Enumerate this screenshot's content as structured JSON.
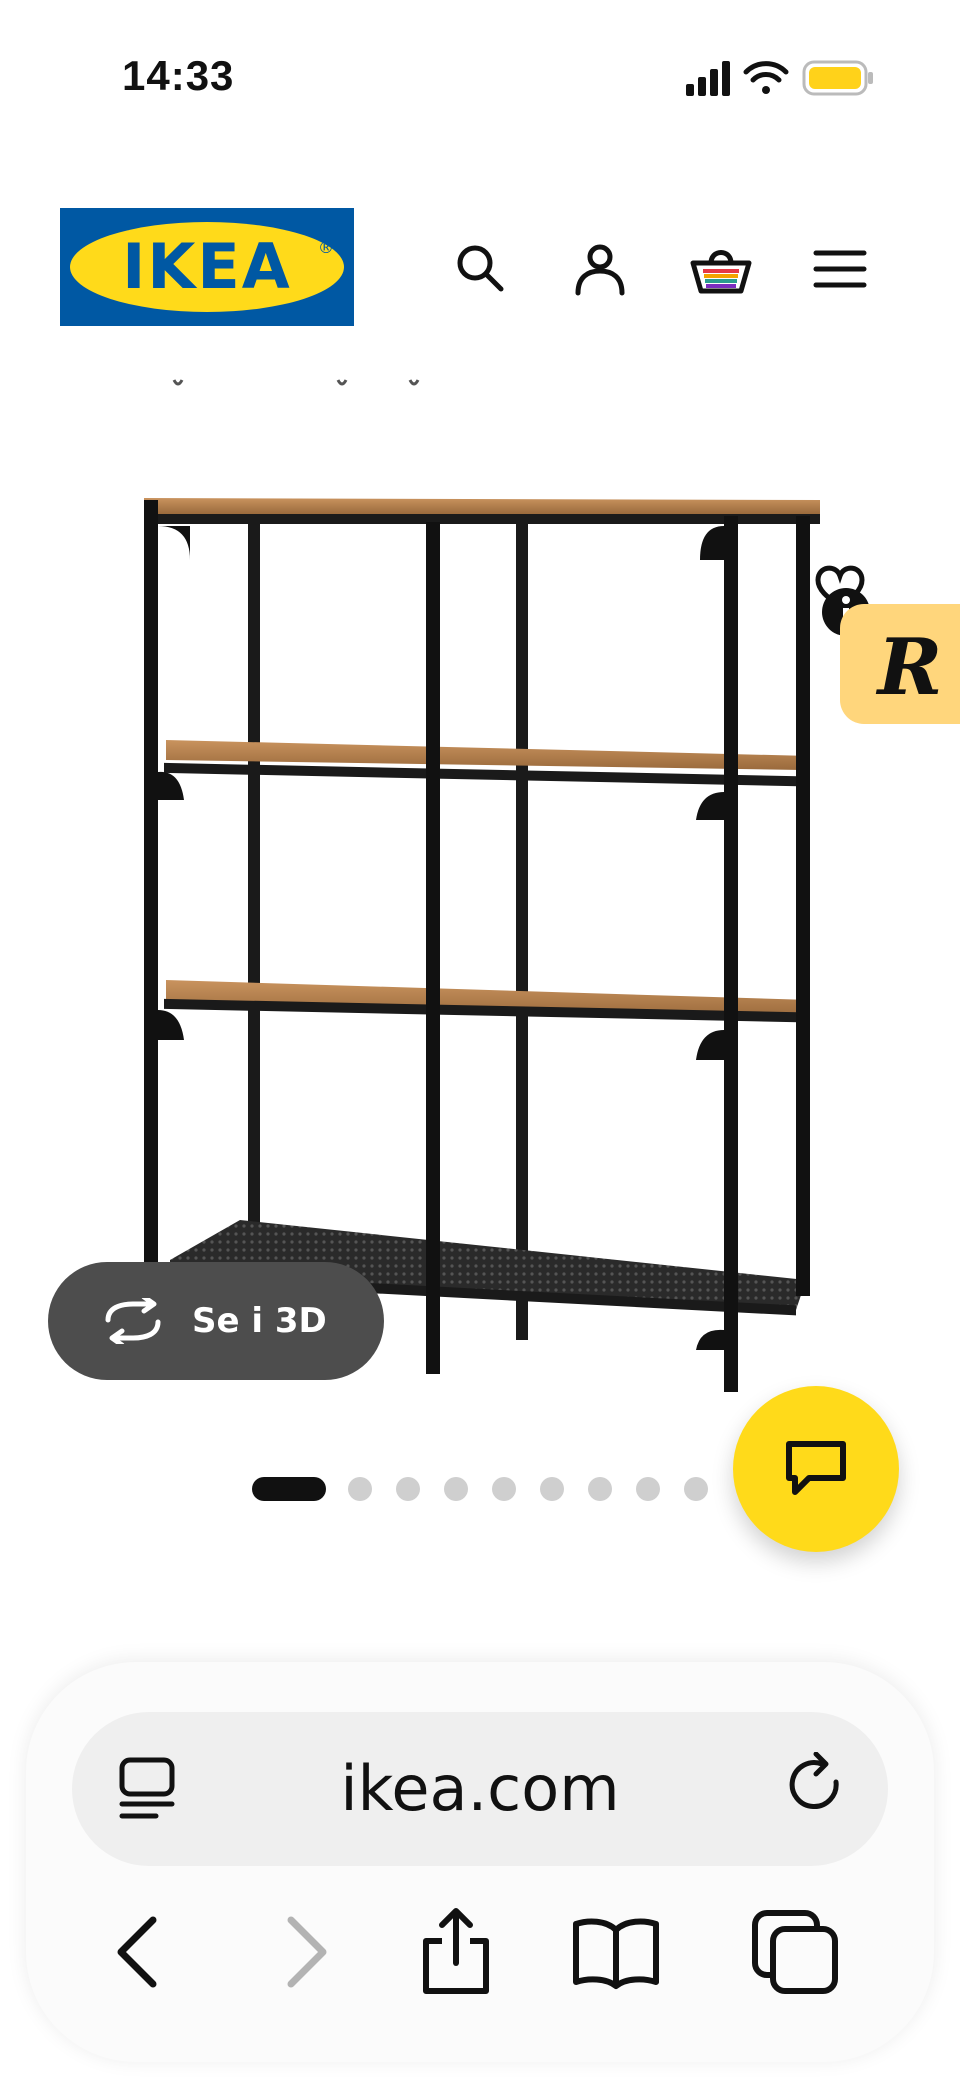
{
  "status_bar": {
    "time": "14:33",
    "icons": [
      "cellular-signal-icon",
      "wifi-icon",
      "battery-icon"
    ],
    "battery_color": "#ffd21a"
  },
  "header": {
    "logo_text": "IKEA",
    "logo_colors": {
      "blue": "#0058a3",
      "yellow": "#ffda1a"
    },
    "icons": [
      "search-icon",
      "account-icon",
      "shopping-bag-icon",
      "menu-icon"
    ]
  },
  "product_gallery": {
    "see_3d_label": "Se i 3D",
    "slide_count": 9,
    "active_slide": 1,
    "badge_letter": "R",
    "badge_color": "#ffd67c"
  },
  "chat": {
    "icon": "chat-bubble-icon",
    "color": "#ffda1a"
  },
  "browser": {
    "url": "ikea.com",
    "toolbar_icons": [
      "reader-view-icon",
      "reload-icon",
      "back-icon",
      "forward-icon",
      "share-icon",
      "bookmarks-icon",
      "tabs-icon"
    ]
  }
}
